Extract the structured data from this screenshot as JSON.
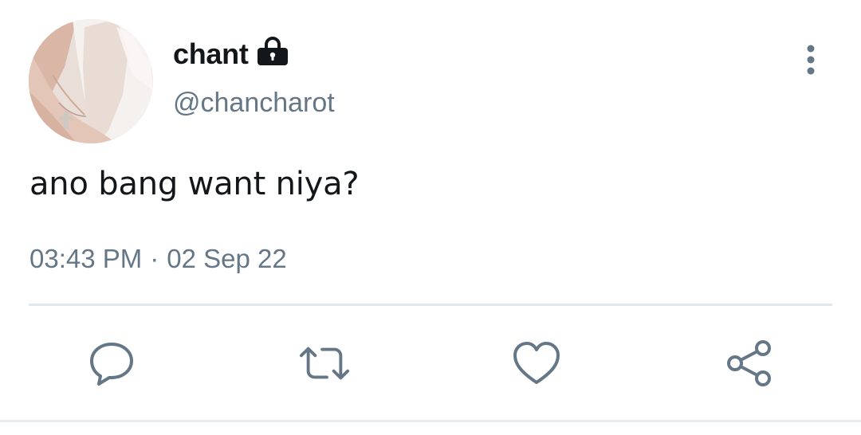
{
  "tweet": {
    "user": {
      "display_name": "chant",
      "handle": "@chancharot",
      "protected": true,
      "avatar": "avatar-photo"
    },
    "text": "ano bang want niya?",
    "time": "03:43 PM",
    "separator": "·",
    "date": "02 Sep 22"
  },
  "icons": {
    "lock": "lock-icon",
    "more": "more-vertical-icon",
    "reply": "reply-icon",
    "retweet": "retweet-icon",
    "like": "heart-icon",
    "share": "share-icon"
  },
  "colors": {
    "text_primary": "#14171a",
    "text_secondary": "#657786",
    "icon": "#657786",
    "divider": "#e1e8ed"
  }
}
